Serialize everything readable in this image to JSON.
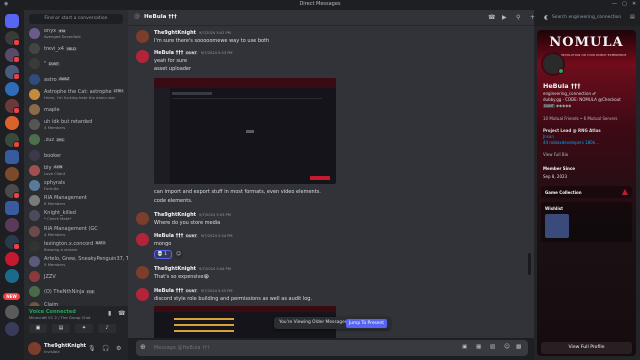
{
  "window": {
    "title": "Direct Messages"
  },
  "dm_sidebar": {
    "search_label": "Find or start a conversation",
    "items": [
      {
        "name": "onyx",
        "tag": "★ta",
        "sub": "Avenged Sevenfold",
        "color": "#6b5b8c"
      },
      {
        "name": "trevi_x4",
        "tag": "VBLD",
        "sub": "",
        "color": "#444"
      },
      {
        "name": "\"",
        "tag": "DUNT",
        "sub": "",
        "color": "#3a3a3a"
      },
      {
        "name": "astro",
        "tag": "AWAZ",
        "sub": "",
        "color": "#2e4d7a"
      },
      {
        "name": "Astrophe the Cat: astrophe",
        "tag": "LTRH",
        "sub": "Hmm, I'm fucking hate the damn war",
        "color": "#c48b3a"
      },
      {
        "name": "maple",
        "tag": "",
        "sub": "",
        "color": "#8a6a4a"
      },
      {
        "name": "uh idk but retarded",
        "tag": "",
        "sub": "4 Members",
        "color": "#555"
      },
      {
        "name": ".zuz",
        "tag": "ZHS",
        "sub": "",
        "color": "#4d6f4d"
      },
      {
        "name": "booker",
        "tag": "",
        "sub": "",
        "color": "#3a3a4a"
      },
      {
        "name": "bly",
        "tag": "AXIN",
        "sub": "Love Client",
        "color": "#a05050"
      },
      {
        "name": "sphyrals",
        "tag": "",
        "sub": "Fortnite",
        "color": "#5a7a9a"
      },
      {
        "name": "RIA Management",
        "tag": "",
        "sub": "8 Members",
        "color": "#7a7a7a"
      },
      {
        "name": "Knight_killed",
        "tag": "",
        "sub": "* Check Mate*",
        "color": "#4a4a5a"
      },
      {
        "name": "RIA Management (GC",
        "tag": "",
        "sub": "4 Members",
        "color": "#6a4a4a"
      },
      {
        "name": "lexington.x.concord",
        "tag": "NATO",
        "sub": "Brewing a stream",
        "color": "#333"
      },
      {
        "name": "Artelo, Grew, SneakyPenguin37, T...",
        "tag": "",
        "sub": "5 Members",
        "color": "#5a5a7a"
      },
      {
        "name": "JZZV",
        "tag": "",
        "sub": "",
        "color": "#8a3a3a"
      },
      {
        "name": "(O) TheNthNinja",
        "tag": "FOE",
        "sub": "",
        "color": "#4a6a4a"
      },
      {
        "name": "Claim",
        "tag": "",
        "sub": "Taking Ut Commissions!",
        "color": "#6a5a3a"
      }
    ],
    "voice": {
      "status": "Voice Connected",
      "channel": "Minecraft VC 2 / The Group Chat"
    },
    "user": {
      "name": "The9ghtKnight",
      "status": "Invisible"
    }
  },
  "chat": {
    "header_name": "HeBula †††",
    "search_placeholder": "Search engineering_connection",
    "messages": [
      {
        "author": "The9ghtKnight",
        "time": "9/7/2024 5:02 PM",
        "lines": [
          "I'm sure there's sooooomewe way to use both"
        ],
        "color": "#7a3e2a"
      },
      {
        "author": "HeBula †††",
        "tag": "DUNT",
        "time": "9/7/2024 5:03 PM",
        "lines": [
          "yeah for sure",
          "asset uploader"
        ],
        "color": "#b3243b"
      },
      {
        "author": "",
        "time": "",
        "lines": [
          "can import and export stuff in most formats, even video elements.",
          "code elements."
        ],
        "color": ""
      },
      {
        "author": "The9ghtKnight",
        "time": "9/7/2024 5:03 PM",
        "lines": [
          "Where do you store media"
        ],
        "color": "#7a3e2a"
      },
      {
        "author": "HeBula †††",
        "tag": "DUNT",
        "time": "9/7/2024 5:04 PM",
        "lines": [
          "mongo"
        ],
        "color": "#b3243b"
      },
      {
        "author": "The9ghtKnight",
        "time": "9/7/2024 5:04 PM",
        "lines": [
          "That's so expensive😭"
        ],
        "color": "#7a3e2a"
      },
      {
        "author": "HeBula †††",
        "tag": "DUNT",
        "time": "9/7/2024 5:05 PM",
        "lines": [
          "discord style role building and permissions as well as audit log."
        ],
        "color": "#b3243b"
      }
    ],
    "reaction": "💀 1",
    "older_banner": "You're Viewing Older Messages",
    "jump_button": "Jump To Present",
    "composer_placeholder": "Message @HeBula †††"
  },
  "profile": {
    "banner_logo": "NOMULA",
    "banner_sub": "JOIN THE REVOLUTION ON YOUR ROBOT EXPERIENCE",
    "display_name": "HeBula †††",
    "username": "engineering_connection ♂",
    "pronouns": "dubby.gg · CODE: NOMULA @Checkout",
    "tag": "DUNT",
    "mutuals": "10 Mutual Friends • 6 Mutual Servers",
    "bio_title": "Project Lead @ RNG Atlas",
    "bio_line2": "Jnsun",
    "bio_line3": "44 robloxdevelopers 180k...",
    "view_bio": "View Full Bio",
    "member_since_label": "Member Since",
    "member_since": "Sep 8, 2023",
    "game_collection": "Game Collection",
    "wishlist": "Wishlist",
    "view_full_profile": "View Full Profile"
  },
  "colors": {
    "accent": "#5865f2",
    "brand_red": "#c41a2f",
    "online": "#23a55a"
  }
}
